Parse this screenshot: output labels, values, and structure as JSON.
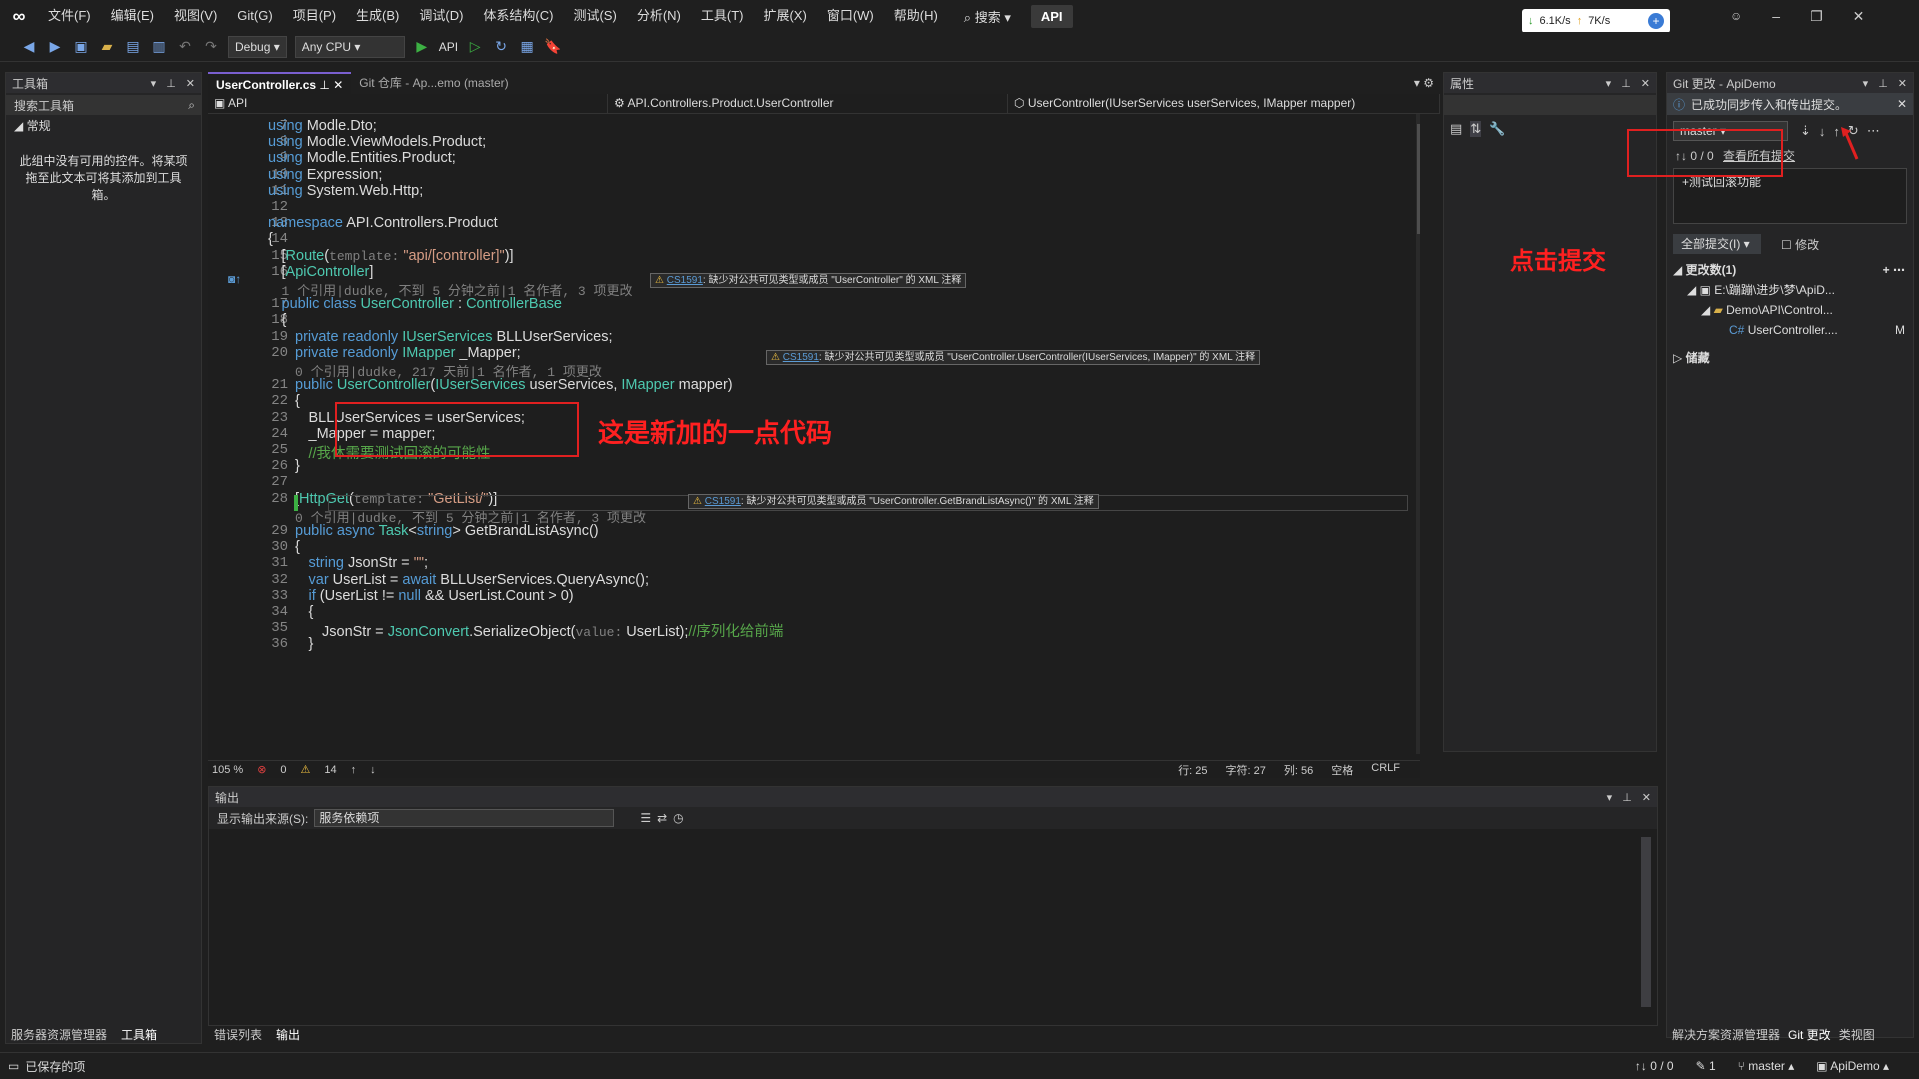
{
  "menu": {
    "items": [
      "文件(F)",
      "编辑(E)",
      "视图(V)",
      "Git(G)",
      "项目(P)",
      "生成(B)",
      "调试(D)",
      "体系结构(C)",
      "测试(S)",
      "分析(N)",
      "工具(T)",
      "扩展(X)",
      "窗口(W)",
      "帮助(H)"
    ],
    "search": "搜索",
    "app_badge": "API"
  },
  "net": {
    "down": "6.1K/s",
    "up": "7K/s"
  },
  "toolbar": {
    "config": "Debug",
    "platform": "Any CPU",
    "run_target": "API"
  },
  "toolbox": {
    "title": "工具箱",
    "search_placeholder": "搜索工具箱",
    "group": "常规",
    "empty_text": "此组中没有可用的控件。将某项拖至此文本可将其添加到工具箱。"
  },
  "left_tabs": {
    "server_explorer": "服务器资源管理器",
    "toolbox": "工具箱"
  },
  "tabs": {
    "active": "UserController.cs",
    "git_repo": "Git 仓库 - Ap...emo (master)"
  },
  "nav": {
    "project": "API",
    "class": "API.Controllers.Product.UserController",
    "member": "UserController(IUserServices userServices, IMapper mapper)"
  },
  "code": {
    "lines": [
      {
        "n": "7",
        "html": "<span class='kw'>using</span> Modle.Dto;",
        "x": 0
      },
      {
        "n": "8",
        "html": "<span class='kw'>using</span> Modle.ViewModels.Product;",
        "x": 0
      },
      {
        "n": "9",
        "html": "<span class='kw'>using</span> Modle.Entities.Product;",
        "x": 0
      },
      {
        "n": "10",
        "html": "<span class='kw'>using</span> Expression;",
        "x": 0
      },
      {
        "n": "11",
        "html": "<span class='kw'>using</span> System.Web.Http;",
        "x": 0
      },
      {
        "n": "12",
        "html": "",
        "x": 0
      },
      {
        "n": "13",
        "html": "<span class='kw'>namespace</span> API.Controllers.Product",
        "x": 0
      },
      {
        "n": "14",
        "html": "{",
        "x": 0
      },
      {
        "n": "15",
        "html": "[<span class='ty'>Route</span>(<span class='ann'>template:</span> <span class='str'>\"api/[controller]\"</span>)]",
        "x": 1
      },
      {
        "n": "16",
        "html": "[<span class='ty'>ApiController</span>]",
        "x": 1
      },
      {
        "n": "",
        "html": "<span class='ann'>1 个引用|dudke, 不到 5 分钟之前|1 名作者, 3 项更改</span>",
        "x": 1
      },
      {
        "n": "17",
        "html": "<span class='kw'>public class</span> <span class='ty'>UserController</span> : <span class='ty'>ControllerBase</span>",
        "x": 1
      },
      {
        "n": "18",
        "html": "{",
        "x": 1
      },
      {
        "n": "19",
        "html": "<span class='kw'>private readonly</span> <span class='ty'>IUserServices</span> BLLUserServices;",
        "x": 2
      },
      {
        "n": "20",
        "html": "<span class='kw'>private readonly</span> <span class='ty'>IMapper</span> _Mapper;",
        "x": 2
      },
      {
        "n": "",
        "html": "<span class='ann'>0 个引用|dudke, 217 天前|1 名作者, 1 项更改</span>",
        "x": 2
      },
      {
        "n": "21",
        "html": "<span class='kw'>public</span> <span class='ty'>UserController</span>(<span class='ty'>IUserServices</span> userServices, <span class='ty'>IMapper</span> mapper)",
        "x": 2
      },
      {
        "n": "22",
        "html": "{",
        "x": 2
      },
      {
        "n": "23",
        "html": "BLLUserServices = userServices;",
        "x": 3
      },
      {
        "n": "24",
        "html": "_Mapper = mapper;",
        "x": 3
      },
      {
        "n": "25",
        "html": "<span class='cm'>//我休需要测试回滚的可能性</span>",
        "x": 3
      },
      {
        "n": "26",
        "html": "}",
        "x": 2
      },
      {
        "n": "27",
        "html": "",
        "x": 0
      },
      {
        "n": "28",
        "html": "[<span class='ty'>HttpGet</span>(<span class='ann'>template:</span> <span class='str'>\"GetList/\"</span>)]",
        "x": 2
      },
      {
        "n": "",
        "html": "<span class='ann'>0 个引用|dudke, 不到 5 分钟之前|1 名作者, 3 项更改</span>",
        "x": 2
      },
      {
        "n": "29",
        "html": "<span class='kw'>public async</span> <span class='ty'>Task</span>&lt;<span class='kw'>string</span>&gt; GetBrandListAsync()",
        "x": 2
      },
      {
        "n": "30",
        "html": "{",
        "x": 2
      },
      {
        "n": "31",
        "html": "<span class='kw'>string</span> JsonStr = <span class='str'>\"\"</span>;",
        "x": 3
      },
      {
        "n": "32",
        "html": "<span class='kw'>var</span> UserList = <span class='kw'>await</span> BLLUserServices.QueryAsync();",
        "x": 3
      },
      {
        "n": "33",
        "html": "<span class='kw'>if</span> (UserList != <span class='kw'>null</span> &amp;&amp; UserList.Count &gt; 0)",
        "x": 3
      },
      {
        "n": "34",
        "html": "{",
        "x": 3
      },
      {
        "n": "35",
        "html": "JsonStr = <span class='ty'>JsonConvert</span>.SerializeObject(<span class='ann'>value:</span> UserList);<span class='cm'>//序列化给前端</span>",
        "x": 4
      },
      {
        "n": "36",
        "html": "}",
        "x": 3
      }
    ]
  },
  "warnings": [
    {
      "code": "CS1591",
      "text": "缺少对公共可见类型或成员 \"UserController\" 的 XML 注释"
    },
    {
      "code": "CS1591",
      "text": "缺少对公共可见类型或成员 \"UserController.UserController(IUserServices, IMapper)\" 的 XML 注释"
    },
    {
      "code": "CS1591",
      "text": "缺少对公共可见类型或成员 \"UserController.GetBrandListAsync()\" 的 XML 注释"
    }
  ],
  "annotations": {
    "new_code": "这是新加的一点代码",
    "click_commit": "点击提交"
  },
  "editor_status": {
    "zoom": "105 %",
    "errors": "0",
    "warnings": "14",
    "line": "行: 25",
    "char": "字符: 27",
    "col": "列: 56",
    "indent": "空格",
    "eol": "CRLF"
  },
  "properties": {
    "title": "属性"
  },
  "git": {
    "title": "Git 更改 - ApiDemo",
    "info": "已成功同步传入和传出提交。",
    "branch": "master",
    "counts": "↑↓ 0 / 0",
    "view_all": "查看所有提交",
    "message": "+测试回滚功能",
    "commit_all": "全部提交(I)",
    "amend": "修改",
    "changes": "更改数(1)",
    "path": "E:\\蹦蹦\\进步\\梦\\ApiD...",
    "folder": "Demo\\API\\Control...",
    "file": "UserController....",
    "file_status": "M",
    "stashes": "储藏"
  },
  "output": {
    "title": "输出",
    "source_label": "显示输出来源(S):",
    "source": "服务依赖项"
  },
  "bottom_tabs": {
    "errors": "错误列表",
    "output": "输出"
  },
  "right_tabs": {
    "solution": "解决方案资源管理器",
    "git": "Git 更改",
    "class_view": "类视图"
  },
  "status": {
    "saved": "已保存的项",
    "sync": "↑↓ 0 / 0",
    "edits": "1",
    "branch": "master",
    "repo": "ApiDemo"
  }
}
